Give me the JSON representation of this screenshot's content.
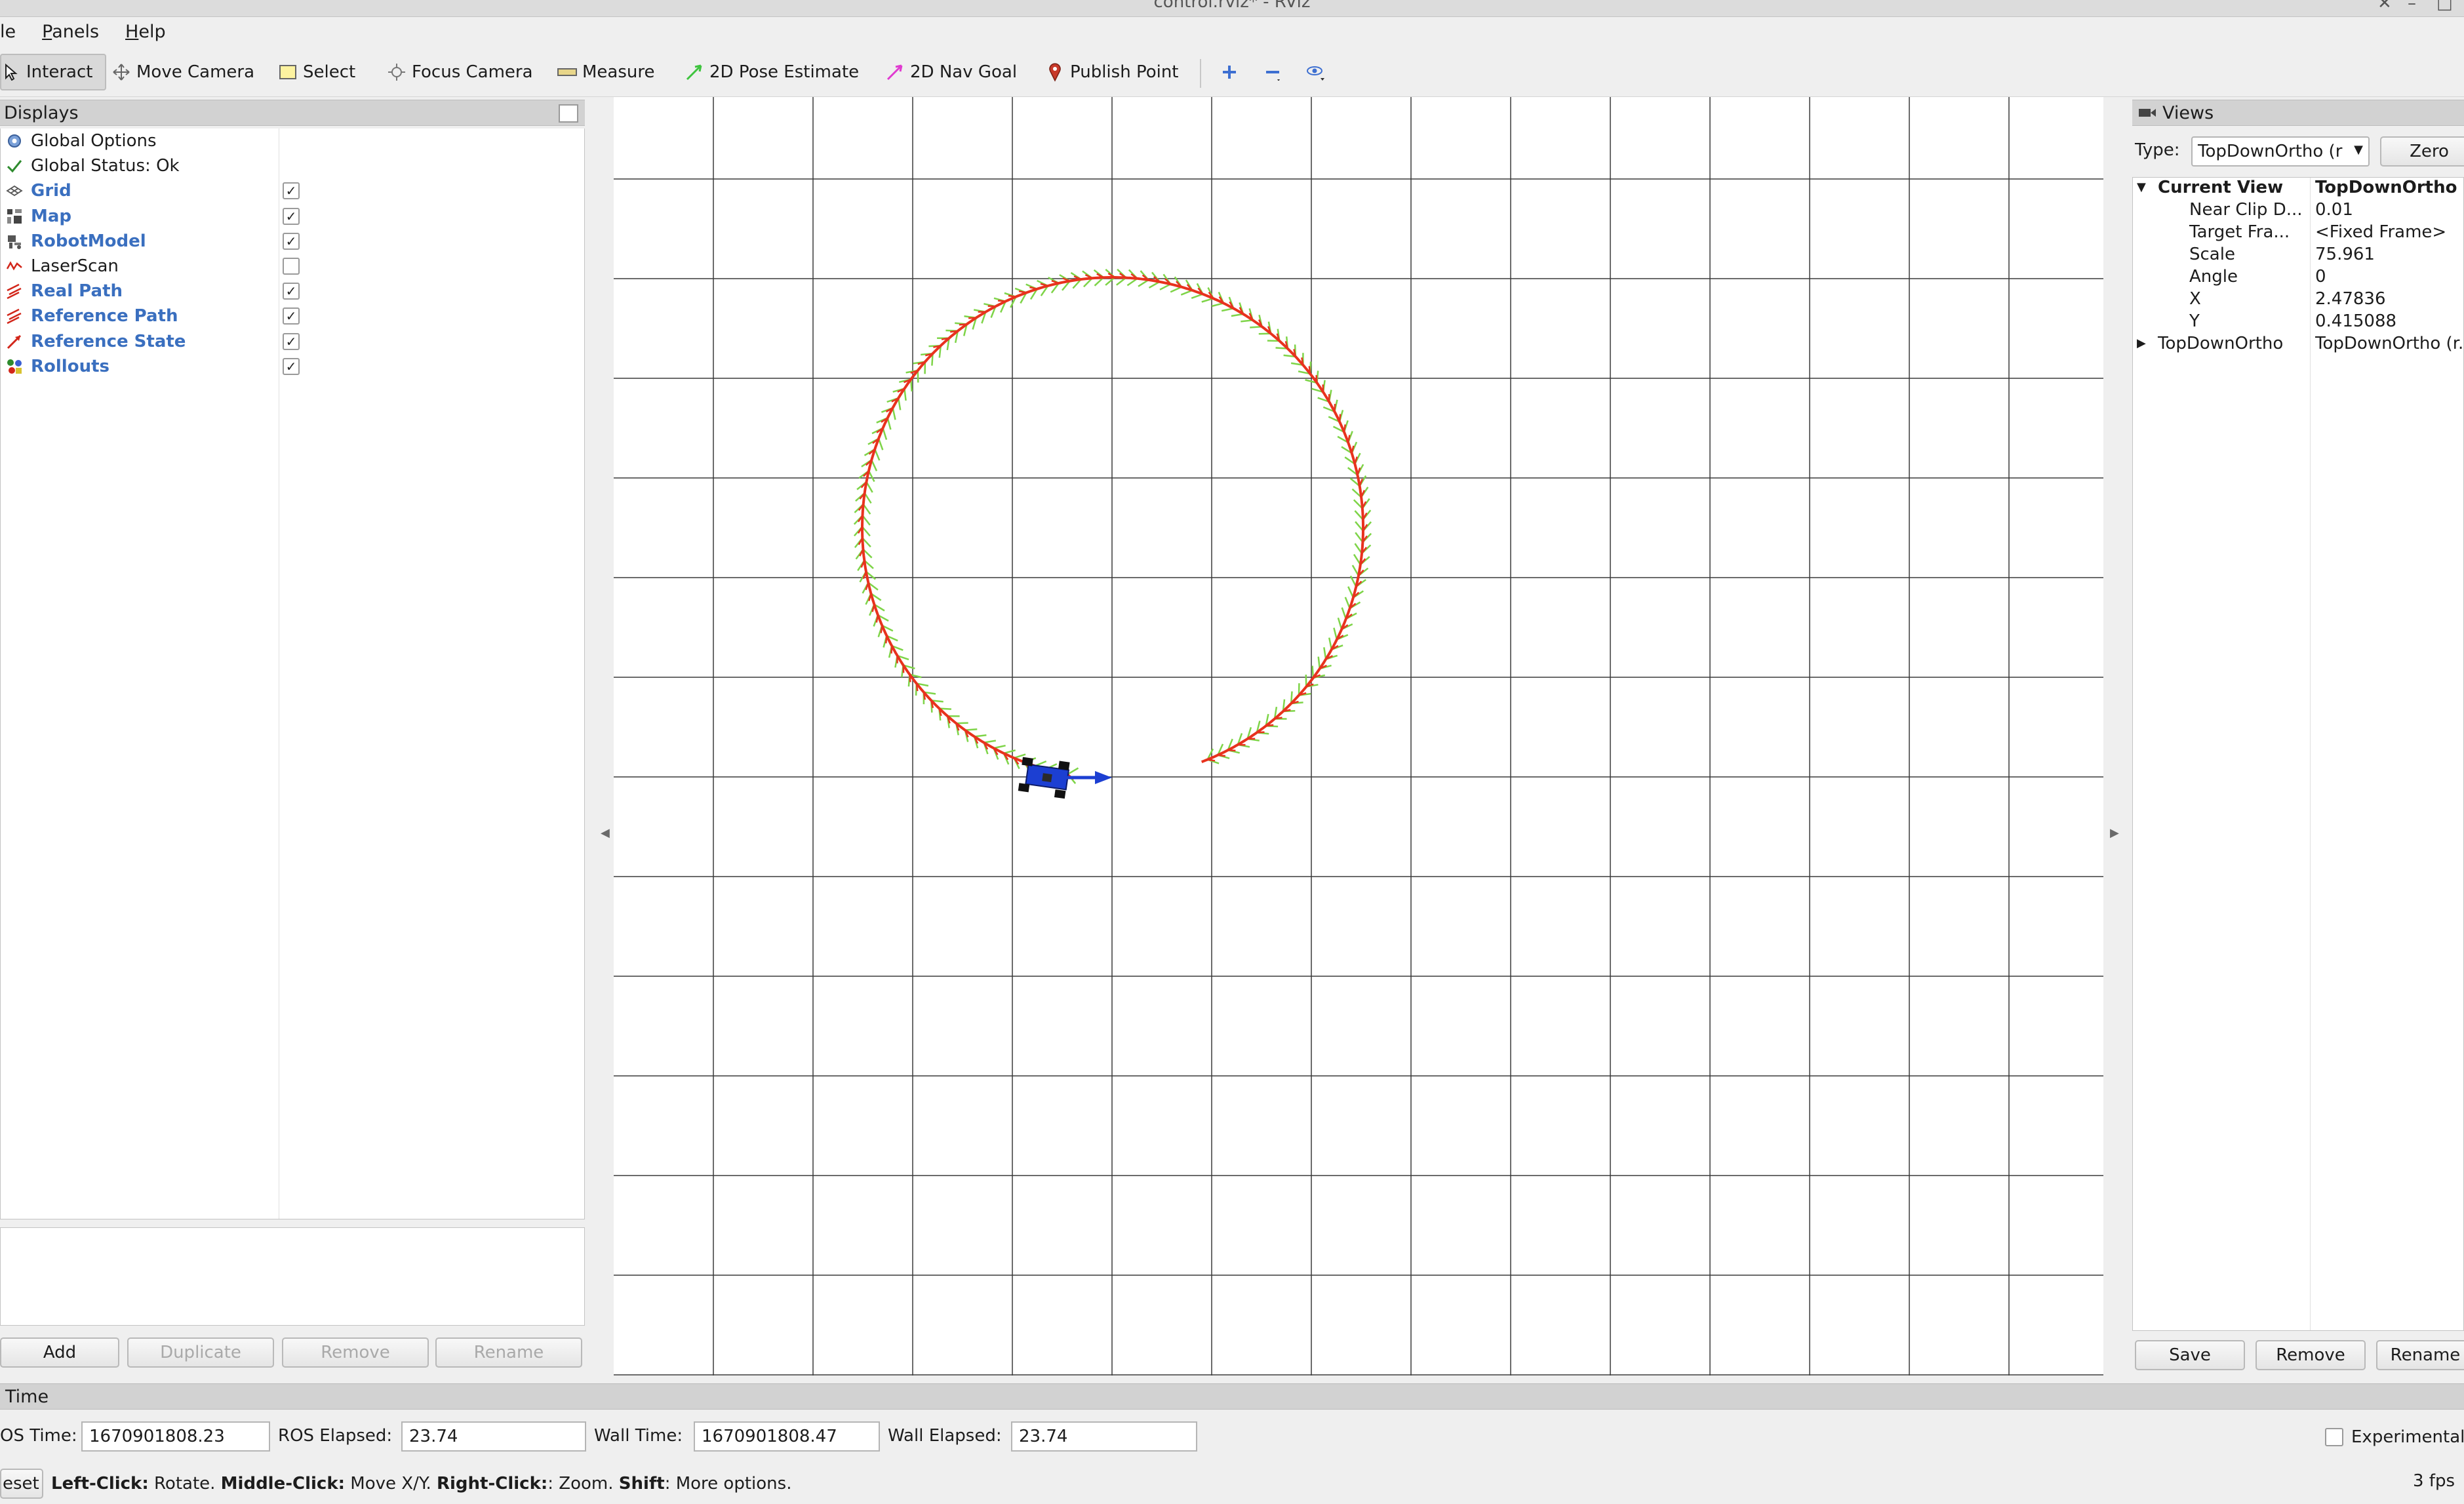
{
  "window": {
    "title": "control.rviz* - RViz"
  },
  "menu": [
    {
      "label": "File",
      "visible": "le"
    },
    {
      "label": "Panels",
      "mnemonic": "P",
      "rest": "anels"
    },
    {
      "label": "Help",
      "mnemonic": "H",
      "rest": "elp"
    }
  ],
  "toolbar": {
    "interact": "Interact",
    "move_camera": "Move Camera",
    "select": "Select",
    "focus_camera": "Focus Camera",
    "measure": "Measure",
    "pose_estimate": "2D Pose Estimate",
    "nav_goal": "2D Nav Goal",
    "publish_point": "Publish Point"
  },
  "displays": {
    "title": "Displays",
    "items": [
      {
        "label": "Global Options",
        "icon": "gear-icon",
        "bold": false,
        "checked": null
      },
      {
        "label": "Global Status: Ok",
        "icon": "checkmark-icon",
        "bold": false,
        "checked": null
      },
      {
        "label": "Grid",
        "icon": "grid-icon",
        "bold": true,
        "checked": true
      },
      {
        "label": "Map",
        "icon": "map-icon",
        "bold": true,
        "checked": true
      },
      {
        "label": "RobotModel",
        "icon": "robot-icon",
        "bold": true,
        "checked": true
      },
      {
        "label": "LaserScan",
        "icon": "laserscan-icon",
        "bold": false,
        "checked": false
      },
      {
        "label": "Real Path",
        "icon": "path-icon",
        "bold": true,
        "checked": true
      },
      {
        "label": "Reference Path",
        "icon": "path-icon",
        "bold": true,
        "checked": true
      },
      {
        "label": "Reference State",
        "icon": "pose-icon",
        "bold": true,
        "checked": true
      },
      {
        "label": "Rollouts",
        "icon": "marker-icon",
        "bold": true,
        "checked": true
      }
    ],
    "buttons": {
      "add": "Add",
      "duplicate": "Duplicate",
      "remove": "Remove",
      "rename": "Rename"
    }
  },
  "views": {
    "title": "Views",
    "type_label": "Type:",
    "type_value": "TopDownOrtho (r",
    "zero": "Zero",
    "current_view": {
      "key": "Current View",
      "value": "TopDownOrtho"
    },
    "props": [
      {
        "key": "Near Clip D...",
        "value": "0.01"
      },
      {
        "key": "Target Fra...",
        "value": "<Fixed Frame>"
      },
      {
        "key": "Scale",
        "value": "75.961"
      },
      {
        "key": "Angle",
        "value": "0"
      },
      {
        "key": "X",
        "value": "2.47836"
      },
      {
        "key": "Y",
        "value": "0.415088"
      }
    ],
    "saved": {
      "key": "TopDownOrtho",
      "value": "TopDownOrtho (r..."
    },
    "buttons": {
      "save": "Save",
      "remove": "Remove",
      "rename": "Rename"
    }
  },
  "time": {
    "title": "Time",
    "ros_time_label": "ROS Time:",
    "ros_time_visible": "OS Time:",
    "ros_time": "1670901808.23",
    "ros_elapsed_label": "ROS Elapsed:",
    "ros_elapsed": "23.74",
    "wall_time_label": "Wall Time:",
    "wall_time": "1670901808.47",
    "wall_elapsed_label": "Wall Elapsed:",
    "wall_elapsed": "23.74",
    "experimental": "Experimental"
  },
  "status": {
    "reset": "eset",
    "hint_left": "Left-Click:",
    "hint_left_txt": " Rotate. ",
    "hint_mid": "Middle-Click:",
    "hint_mid_txt": " Move X/Y. ",
    "hint_right": "Right-Click:",
    "hint_right_txt": ": Zoom. ",
    "hint_shift": "Shift",
    "hint_shift_txt": ": More options.",
    "fps": "3 fps"
  },
  "colors": {
    "reference_path": "#e8321e",
    "rollouts": "#7ed448",
    "robot": "#1c3fd2",
    "grid": "#3a3a3a"
  }
}
